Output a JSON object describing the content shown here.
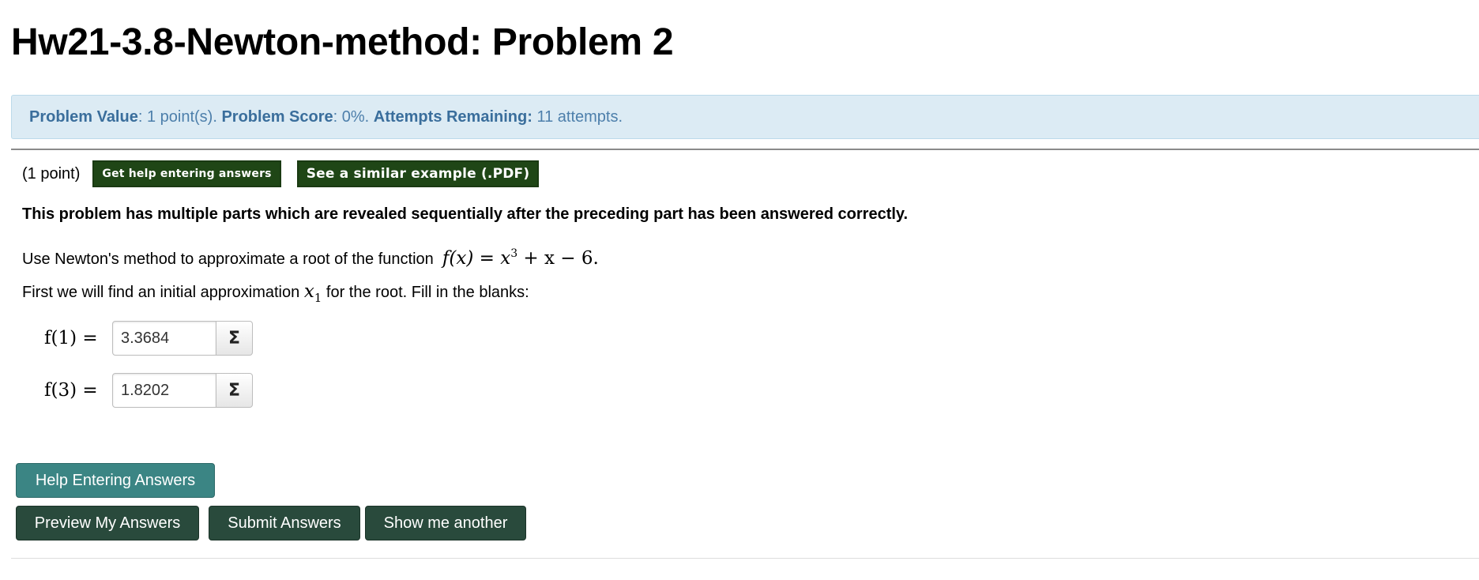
{
  "page": {
    "title": "Hw21-3.8-Newton-method: Problem 2"
  },
  "info_bar": {
    "value_label": "Problem Value",
    "value_text": ": 1 point(s).",
    "score_label": "Problem Score",
    "score_text": ": 0%.",
    "attempts_label": "Attempts Remaining:",
    "attempts_text": "11 attempts."
  },
  "problem": {
    "points": "(1 point)",
    "help_link_label": "Get help entering answers",
    "example_link_label": "See a similar example (.PDF)",
    "intro_bold": "This problem has multiple parts which are revealed sequentially after the preceding part has been answered correctly.",
    "instruction_text": "Use Newton's method to approximate a root of the function",
    "function_expr": {
      "lhs": "f(x) = x",
      "exponent": "3",
      "rhs": " + x − 6."
    },
    "step_text_before": "First we will find an initial approximation",
    "step_var": "x",
    "step_var_sub": "1",
    "step_text_after": "for the root. Fill in the blanks:",
    "answers": [
      {
        "label": "f(1) =",
        "value": "3.3684"
      },
      {
        "label": "f(3) =",
        "value": "1.8202"
      }
    ],
    "sigma_glyph": "Σ"
  },
  "buttons": {
    "help_entering": "Help Entering Answers",
    "preview": "Preview My Answers",
    "submit": "Submit Answers",
    "show_another": "Show me another"
  },
  "colors": {
    "info_bar_bg": "#dcebf4",
    "info_text": "#3c75a6",
    "pill_bg": "#1f4616",
    "help_button_bg": "#3b8584",
    "dark_button_bg": "#294a3c"
  }
}
